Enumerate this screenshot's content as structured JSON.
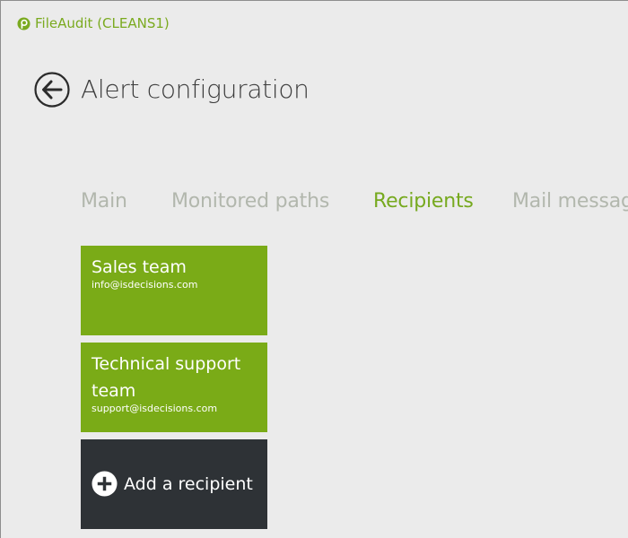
{
  "app": {
    "title": "FileAudit (CLEANS1)",
    "logo_icon": "fileaudit-logo-icon",
    "accent_color": "#7aaa1f"
  },
  "header": {
    "back_icon": "back-arrow-icon",
    "title": "Alert configuration"
  },
  "tabs": [
    {
      "label": "Main",
      "active": false
    },
    {
      "label": "Monitored paths",
      "active": false
    },
    {
      "label": "Recipients",
      "active": true
    },
    {
      "label": "Mail message",
      "active": false
    }
  ],
  "recipients": [
    {
      "name": "Sales team",
      "email": "info@isdecisions.com"
    },
    {
      "name": "Technical support team",
      "email": "support@isdecisions.com"
    }
  ],
  "add_recipient": {
    "label": "Add a recipient",
    "icon": "plus-circle-icon"
  },
  "colors": {
    "tile_green": "#7aab17",
    "tile_dark": "#2e3236",
    "tab_inactive": "#b2b7ad",
    "tab_active": "#76a91e"
  }
}
